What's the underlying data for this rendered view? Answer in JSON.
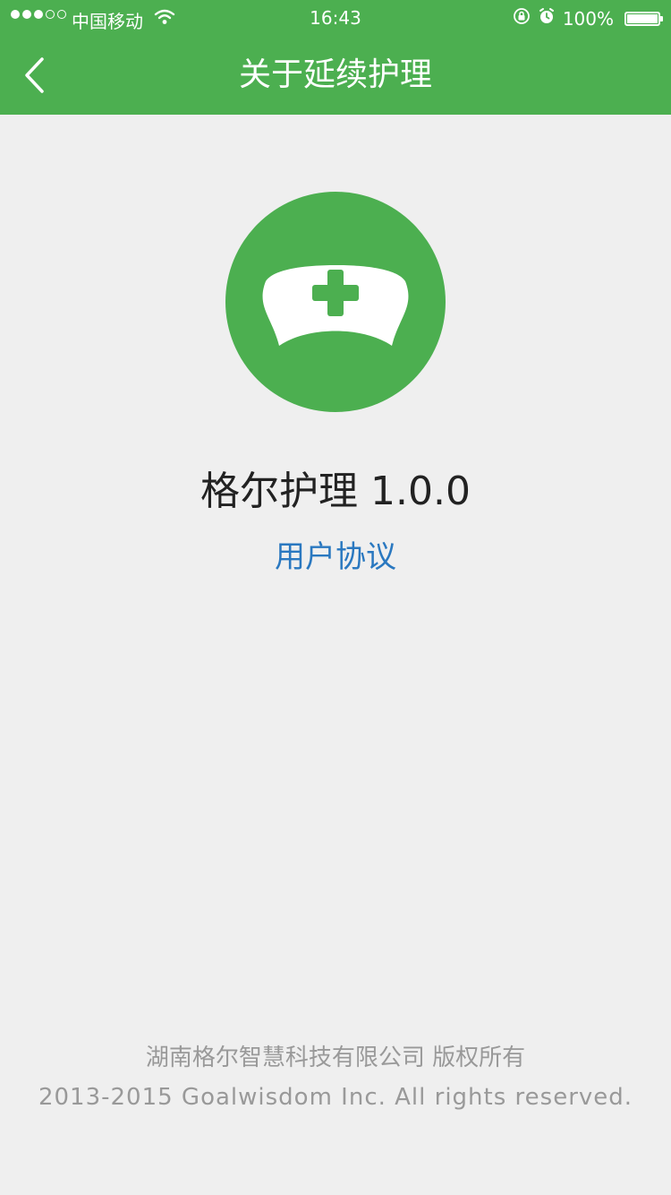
{
  "status_bar": {
    "signal_filled": 3,
    "signal_total": 5,
    "carrier": "中国移动",
    "time": "16:43",
    "battery_text": "100%",
    "battery_level": 1.0
  },
  "nav": {
    "title": "关于延续护理",
    "back_icon": "chevron-left-icon"
  },
  "app": {
    "logo_icon": "nurse-cap-icon",
    "name_version": "格尔护理 1.0.0",
    "agreement_link": "用户协议"
  },
  "footer": {
    "company": "湖南格尔智慧科技有限公司 版权所有",
    "rights": "2013-2015 Goalwisdom Inc. All rights reserved."
  },
  "colors": {
    "primary": "#4caf50",
    "background": "#efefef",
    "link": "#2a78c0",
    "footer_text": "#999999"
  }
}
